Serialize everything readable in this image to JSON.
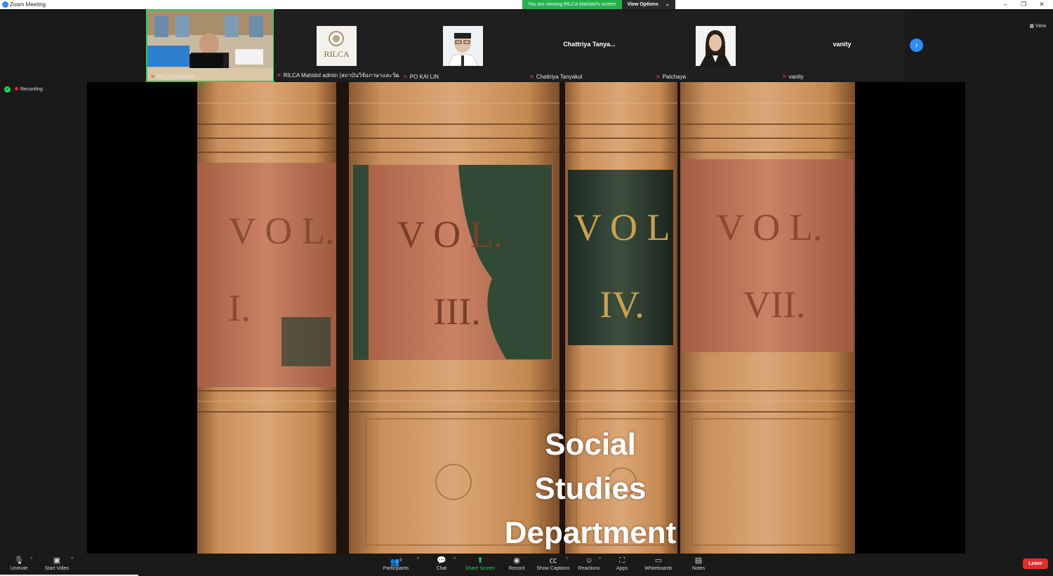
{
  "window": {
    "title": "Zoom Meeting",
    "minimize": "–",
    "restore": "❐",
    "close": "✕"
  },
  "share_banner": {
    "text": "You are viewing RILCA Mahidol's screen",
    "options_label": "View Options",
    "options_caret": "⌄"
  },
  "view_button": "View",
  "participants_strip": [
    {
      "name": "RILCA Mahidol",
      "type": "video",
      "active": true
    },
    {
      "name": "RILCA Mahidol admin (สถาบันวิจัยภาษาและวัฒนธ...",
      "type": "logo",
      "logo_text": "RILCA"
    },
    {
      "name": "PO KAI LIN",
      "type": "photo"
    },
    {
      "name": "Chattriya Tanyakul",
      "type": "text",
      "display": "Chattriya  Tanya..."
    },
    {
      "name": "Patchaya",
      "type": "photo"
    },
    {
      "name": "vanity",
      "type": "text",
      "display": "vanity"
    }
  ],
  "recording": {
    "label": "Recording"
  },
  "slide": {
    "title_line1": "Social Studies",
    "title_line2": "Department",
    "volumes": [
      "V O L.",
      "V O L.",
      "V O L",
      "V O L."
    ],
    "volume_numbers": [
      "I.",
      "III.",
      "IV.",
      "VII."
    ]
  },
  "toolbar": {
    "unmute": "Unmute",
    "start_video": "Start Video",
    "participants": "Participants",
    "participants_count": "9",
    "chat": "Chat",
    "share_screen": "Share Screen",
    "record": "Record",
    "show_captions": "Show Captions",
    "reactions": "Reactions",
    "apps": "Apps",
    "whiteboards": "Whiteboards",
    "notes": "Notes",
    "leave": "Leave"
  },
  "colors": {
    "accent_green": "#23d160",
    "zoom_blue": "#2d8cff",
    "leave_red": "#e02d2d"
  }
}
